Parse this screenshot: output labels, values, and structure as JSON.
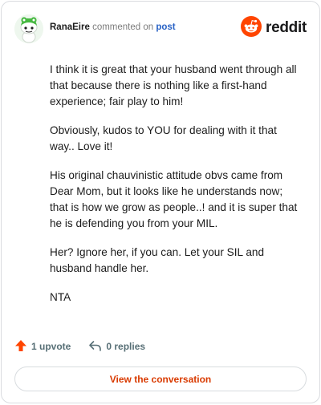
{
  "header": {
    "username": "RanaEire",
    "action": "commented on",
    "target": "post",
    "brand": "reddit",
    "avatar_icon": "frog-snoo-avatar-icon",
    "brand_icon": "reddit-alien-logo-icon",
    "brand_color": "#ff4500"
  },
  "comment": {
    "paragraphs": [
      "I think it is great that your husband went through all that because there is nothing like a first-hand experience; fair play to him!",
      "Obviously, kudos to YOU for dealing with it that way.. Love it!",
      "His original chauvinistic attitude obvs came from Dear Mom, but it looks like he understands now; that is how we grow as people..! and it is super that he is defending you from your MIL.",
      "Her? Ignore her, if you can. Let your SIL and husband handle her.",
      "NTA"
    ]
  },
  "footer": {
    "upvotes_label": "1 upvote",
    "replies_label": "0 replies",
    "upvote_icon": "upvote-arrow-icon",
    "reply_icon": "reply-arrow-icon",
    "cta_label": "View the conversation"
  }
}
